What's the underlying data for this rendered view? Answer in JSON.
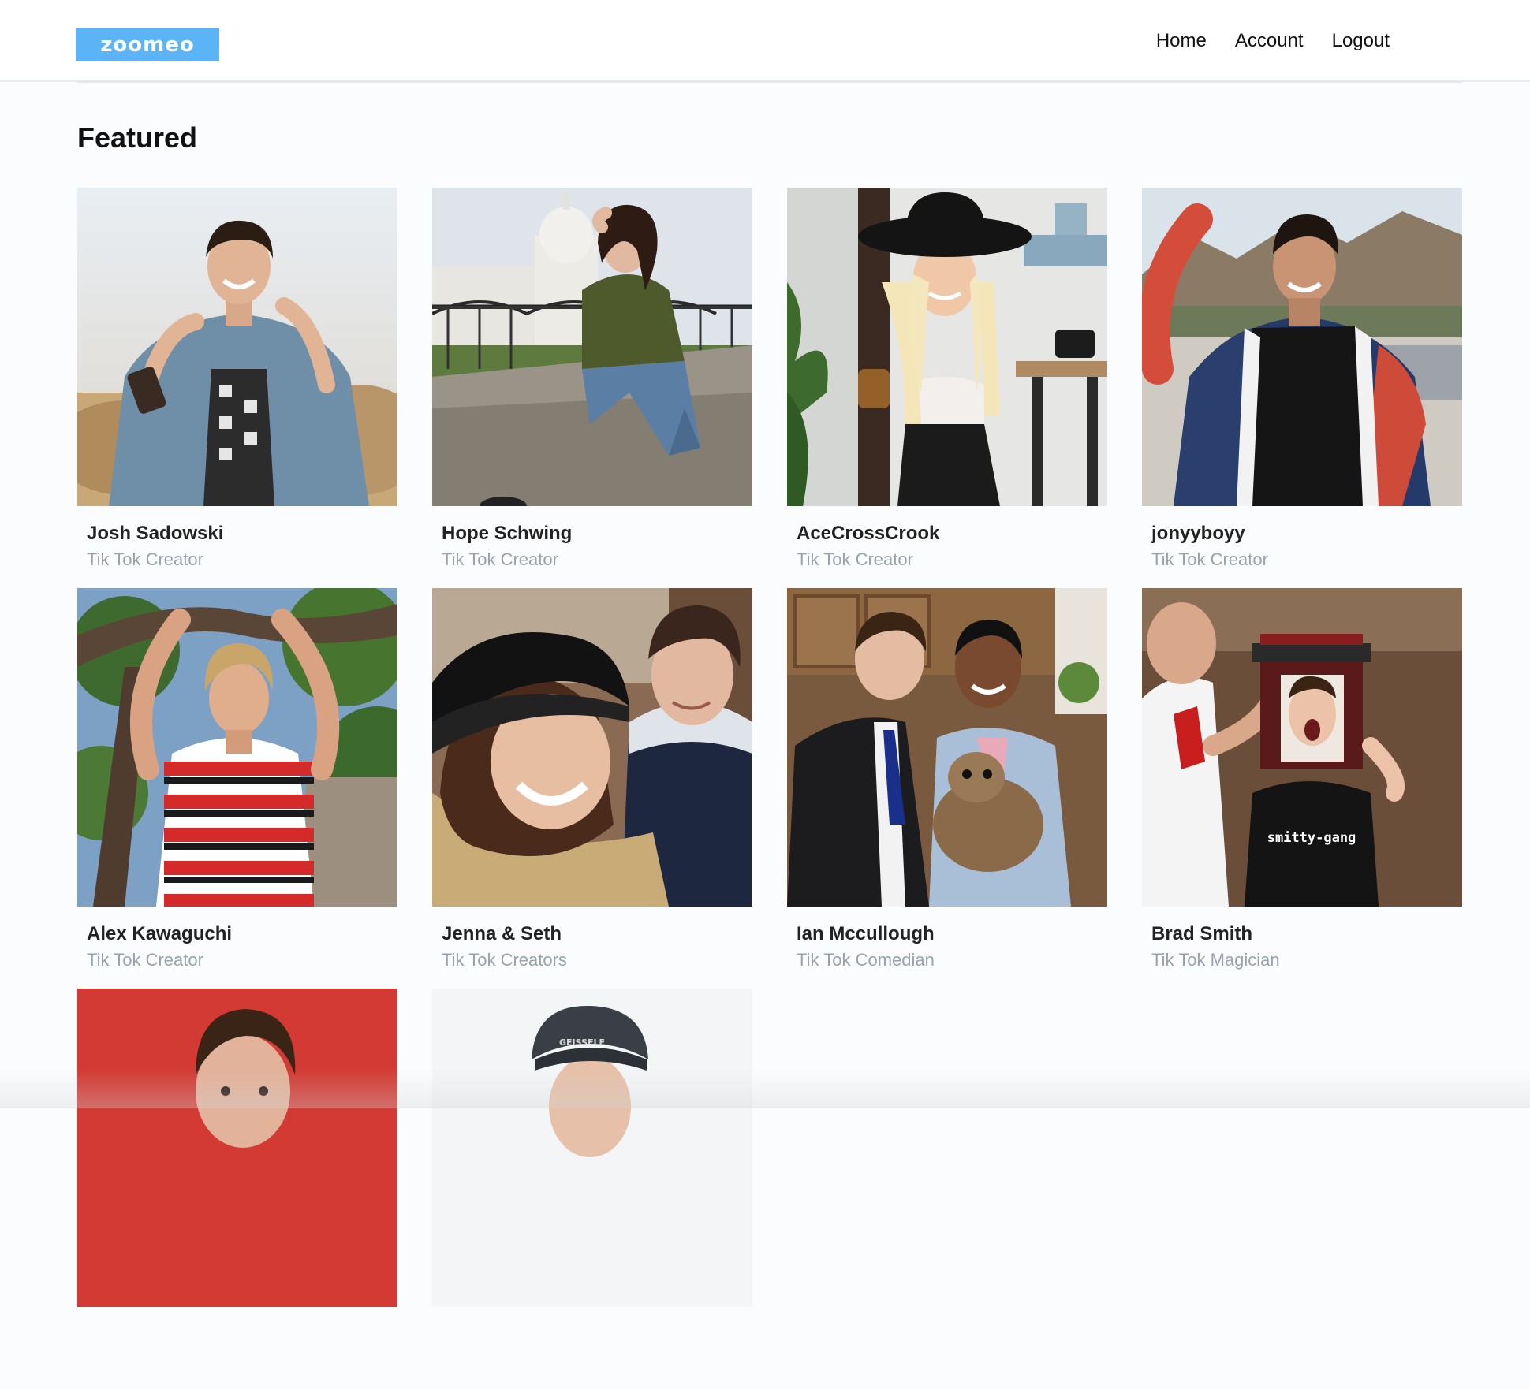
{
  "header": {
    "logo_text": "zoomeo",
    "nav": [
      "Home",
      "Account",
      "Logout"
    ]
  },
  "main": {
    "title": "Featured",
    "cards": [
      {
        "name": "Josh Sadowski",
        "role": "Tik Tok Creator"
      },
      {
        "name": "Hope Schwing",
        "role": "Tik Tok Creator"
      },
      {
        "name": "AceCrossCrook",
        "role": "Tik Tok Creator"
      },
      {
        "name": "jonyyboyy",
        "role": "Tik Tok Creator"
      },
      {
        "name": "Alex Kawaguchi",
        "role": "Tik Tok Creator"
      },
      {
        "name": "Jenna & Seth",
        "role": "Tik Tok Creators"
      },
      {
        "name": "Ian Mccullough",
        "role": "Tik Tok Comedian"
      },
      {
        "name": "Brad Smith",
        "role": "Tik Tok Magician"
      },
      {
        "name": "",
        "role": ""
      },
      {
        "name": "",
        "role": ""
      }
    ],
    "photo_art": {
      "brad_shirt_text": "smitty-gang",
      "cap_text": "GEISSELE"
    }
  },
  "colors": {
    "logo_bg": "#5bb4f5",
    "role_text": "#9aa1ad",
    "page_bg": "#fbfcfd"
  }
}
